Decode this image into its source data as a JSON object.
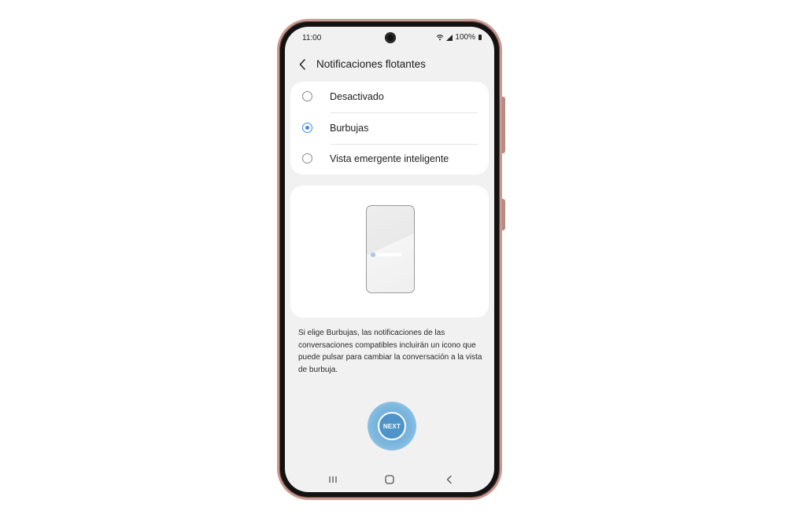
{
  "status_bar": {
    "time": "11:00",
    "battery": "100%",
    "icons": [
      "wifi-icon",
      "signal-icon",
      "battery-icon"
    ]
  },
  "header": {
    "title": "Notificaciones flotantes",
    "back_icon": "chevron-left-icon"
  },
  "options": [
    {
      "label": "Desactivado",
      "selected": false
    },
    {
      "label": "Burbujas",
      "selected": true
    },
    {
      "label": "Vista emergente inteligente",
      "selected": false
    }
  ],
  "description": "Si elige Burbujas, las notificaciones de las conversaciones compatibles incluirán un icono que puede pulsar para cambiar la conversación a la vista de burbuja.",
  "next_button": {
    "label": "NEXT"
  },
  "navbar": {
    "icons": [
      "recents-icon",
      "home-icon",
      "back-icon"
    ]
  },
  "colors": {
    "accent": "#3e88e8",
    "screen_bg": "#f1f1f1",
    "card_bg": "#ffffff",
    "phone_frame": "#c79a92",
    "next_button": "#4f94c8"
  }
}
